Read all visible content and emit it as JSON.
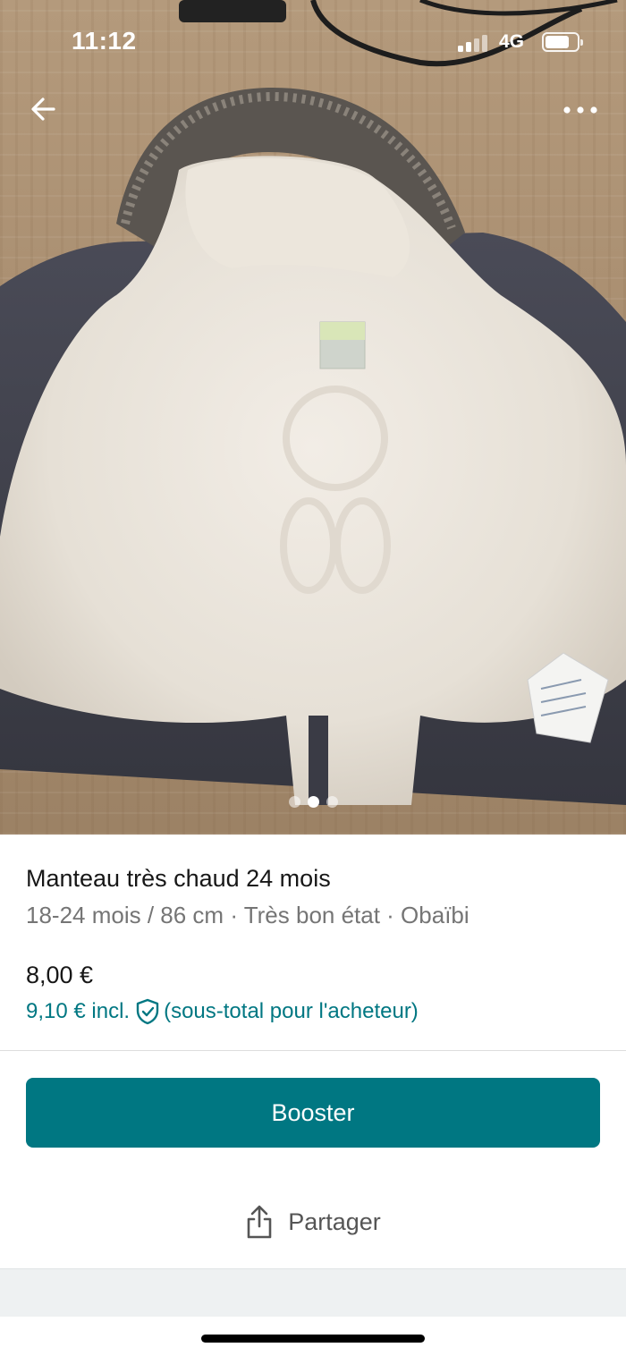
{
  "status_bar": {
    "time": "11:12",
    "network": "4G",
    "signal_bars": 2,
    "signal_bars_total": 4,
    "battery_level": 0.65
  },
  "nav": {
    "back_icon": "arrow-left-icon",
    "more_icon": "more-horizontal-icon"
  },
  "gallery": {
    "image_count": 3,
    "active_index": 1
  },
  "listing": {
    "title": "Manteau très chaud 24 mois",
    "subtitle": "18-24 mois / 86 cm · Très bon état · Obaïbi",
    "price": "8,00 €",
    "price_incl": "9,10 € incl.",
    "price_incl_note": "(sous-total pour l'acheteur)",
    "protection_icon": "shield-check-icon"
  },
  "actions": {
    "booster_label": "Booster",
    "share_label": "Partager",
    "share_icon": "share-icon"
  },
  "colors": {
    "accent": "#007782",
    "text_primary": "#171717",
    "text_secondary": "#757575"
  }
}
